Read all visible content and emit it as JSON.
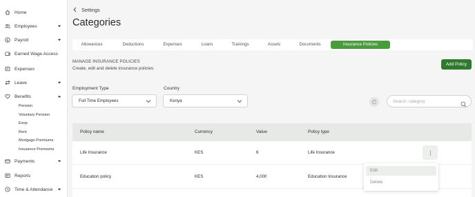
{
  "sidebar": {
    "items": [
      {
        "label": "Home",
        "icon": "home-icon"
      },
      {
        "label": "Employees",
        "icon": "people-icon",
        "expandable": true
      },
      {
        "label": "Payroll",
        "icon": "dollar-icon",
        "expandable": true
      },
      {
        "label": "Earned Wage Access",
        "icon": "wallet-icon"
      },
      {
        "label": "Expenses",
        "icon": "receipt-icon"
      },
      {
        "label": "Leave",
        "icon": "arrows-icon",
        "expandable": true
      },
      {
        "label": "Benefits",
        "icon": "heart-icon",
        "expandable": true,
        "expanded": true
      },
      {
        "label": "Payments",
        "icon": "card-icon",
        "expandable": true
      },
      {
        "label": "Reports",
        "icon": "doc-icon"
      },
      {
        "label": "Time & Attendance",
        "icon": "clock-icon",
        "expandable": true
      }
    ],
    "benefits_sub": [
      "Pension",
      "Voluntary Pension",
      "Esop",
      "Rent",
      "Mortgage Premiums",
      "Insurance Premiums"
    ]
  },
  "header": {
    "breadcrumb": "Settings",
    "title": "Categories"
  },
  "tabs": [
    {
      "label": "Allowances"
    },
    {
      "label": "Deductions"
    },
    {
      "label": "Expenses"
    },
    {
      "label": "Loans"
    },
    {
      "label": "Trainings"
    },
    {
      "label": "Assets"
    },
    {
      "label": "Documents"
    },
    {
      "label": "Insurance Policies",
      "active": true
    }
  ],
  "section": {
    "title": "MANAGE INSURANCE POLICIES",
    "subtitle": "Create, edit and delete insurance policies",
    "add_button": "Add Policy"
  },
  "filters": {
    "employment_type_label": "Employment Type",
    "employment_type_value": "Full Time Employees",
    "country_label": "Country",
    "country_value": "Kenya",
    "search_placeholder": "Search: category"
  },
  "table": {
    "columns": [
      "Policy name",
      "Currency",
      "Value",
      "Policy type"
    ],
    "rows": [
      {
        "name": "Life Insurance",
        "currency": "KES",
        "value": "6",
        "type": "Life Insurance"
      },
      {
        "name": "Education policy",
        "currency": "KES",
        "value": "4,000",
        "type": "Education Insurance"
      }
    ]
  },
  "row_menu": {
    "edit": "Edit",
    "delete": "Delete"
  },
  "colors": {
    "accent": "#4a9a3e",
    "primary_button": "#2f7a2e",
    "background": "#f4f5f4"
  }
}
